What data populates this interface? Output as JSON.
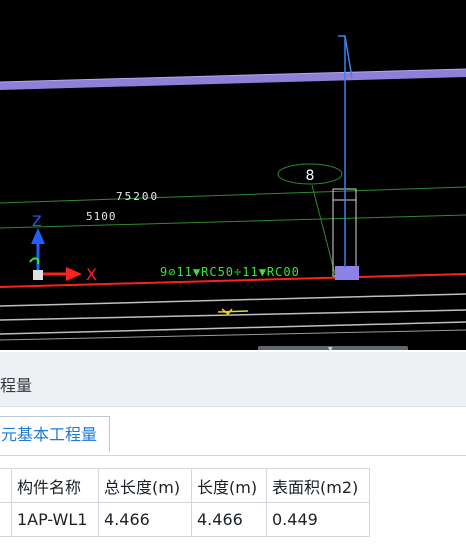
{
  "viewport": {
    "labels": {
      "dim_upper": "75200",
      "dim_lower": "5100",
      "rebar_text": "9⊘11▼RC50÷11▼RC00",
      "axis_x": "X",
      "axis_z": "Z",
      "bubble_label": "8"
    },
    "colors": {
      "background": "#000000",
      "beam": "#8d80d6",
      "green_line": "#2e8b2e",
      "red_line": "#ff2020",
      "label_green": "#33e833",
      "vertical_blue": "#3b82f0"
    }
  },
  "panel": {
    "title": "程量",
    "tab_label": "元基本工程量",
    "table": {
      "headers": [
        "",
        "构件名称",
        "总长度(m)",
        "长度(m)",
        "表面积(m2)"
      ],
      "rows": [
        [
          "",
          "1AP-WL1",
          "4.466",
          "4.466",
          "0.449"
        ]
      ]
    }
  }
}
